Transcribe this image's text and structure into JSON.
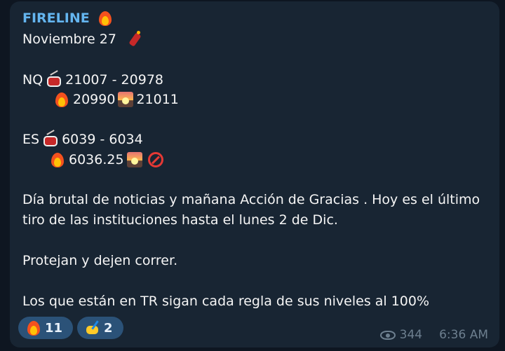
{
  "message": {
    "sender": "FIRELINE",
    "date_line": "Noviembre 27",
    "nq_label": "NQ",
    "nq_range": "21007 - 20978",
    "nq_level1": "20990",
    "nq_level2": "21011",
    "es_label": "ES",
    "es_range": "6039 - 6034",
    "es_level1": "6036.25",
    "body_line1": "Día brutal de noticias y mañana Acción de Gracias . Hoy es el último",
    "body_line2": "tiro de las instituciones hasta el lunes 2 de Dic.",
    "body_line3": "Protejan y dejen correr.",
    "body_line4": "Los que están en TR sigan cada regla de sus niveles al 100%"
  },
  "reactions": [
    {
      "icon": "fire-icon",
      "count": "11"
    },
    {
      "icon": "writing-hand-icon",
      "count": "2"
    }
  ],
  "meta": {
    "views": "344",
    "time": "6:36 AM"
  },
  "colors": {
    "background": "#0e1621",
    "bubble": "#182533",
    "sender": "#64b5ef",
    "reaction_bg": "#2b5278"
  }
}
